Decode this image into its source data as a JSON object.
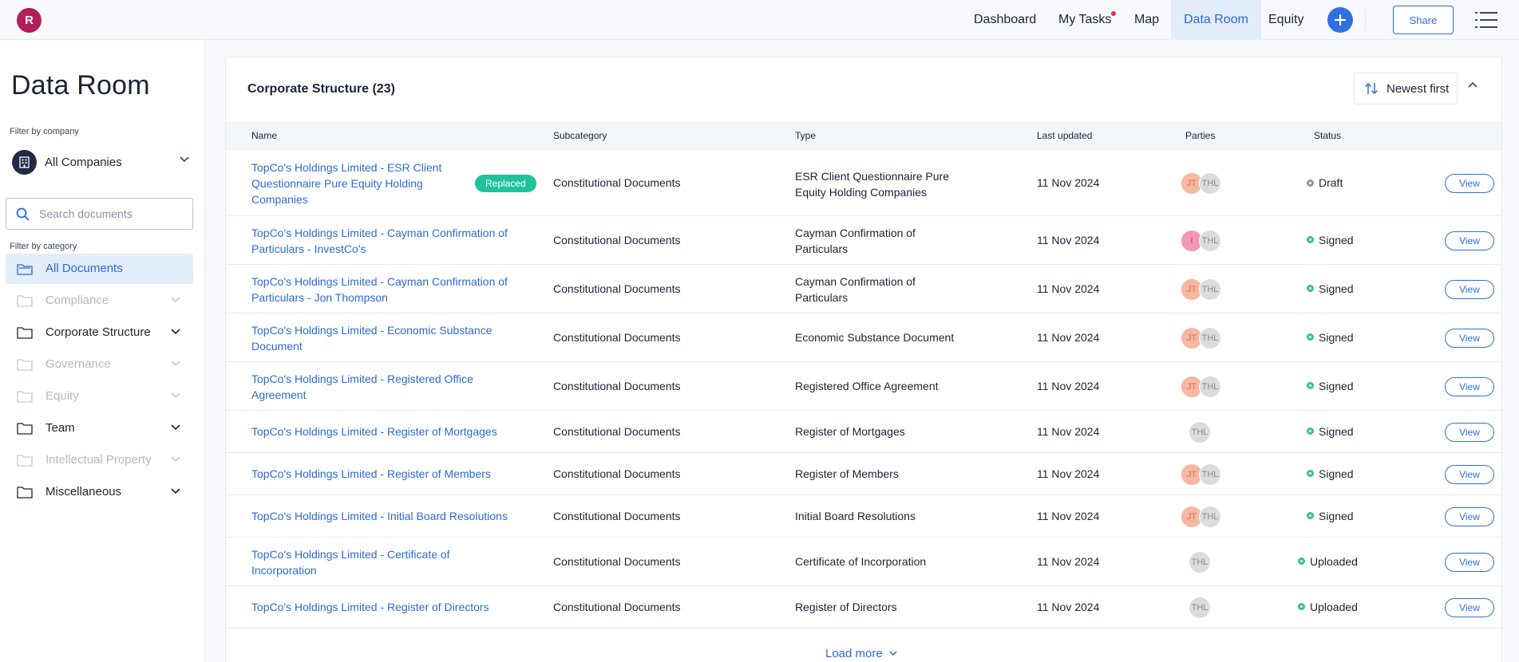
{
  "user": {
    "initial": "R"
  },
  "nav": {
    "items": [
      {
        "label": "Dashboard"
      },
      {
        "label": "My Tasks"
      },
      {
        "label": "Map"
      },
      {
        "label": "Data Room"
      },
      {
        "label": "Equity"
      }
    ],
    "share_label": "Share"
  },
  "sidebar": {
    "title": "Data Room",
    "filter_company_label": "Filter by company",
    "company": "All Companies",
    "search_placeholder": "Search documents",
    "filter_category_label": "Filter by category",
    "categories": [
      {
        "label": "All Documents",
        "state": "active"
      },
      {
        "label": "Compliance",
        "state": "disabled"
      },
      {
        "label": "Corporate Structure",
        "state": "normal"
      },
      {
        "label": "Governance",
        "state": "disabled"
      },
      {
        "label": "Equity",
        "state": "disabled"
      },
      {
        "label": "Team",
        "state": "normal"
      },
      {
        "label": "Intellectual Property",
        "state": "disabled"
      },
      {
        "label": "Miscellaneous",
        "state": "normal"
      }
    ]
  },
  "main": {
    "title": "Corporate Structure (23)",
    "sort_label": "Newest first",
    "columns": {
      "name": "Name",
      "subcategory": "Subcategory",
      "type": "Type",
      "last_updated": "Last updated",
      "parties": "Parties",
      "status": "Status"
    },
    "rows": [
      {
        "name": "TopCo's Holdings Limited - ESR Client Questionnaire Pure Equity Holding Companies",
        "badge": "Replaced",
        "subcategory": "Constitutional Documents",
        "type": "ESR Client Questionnaire Pure Equity Holding Companies",
        "date": "11 Nov 2024",
        "parties": [
          "JT",
          "THL"
        ],
        "status": "Draft"
      },
      {
        "name": "TopCo's Holdings Limited - Cayman Confirmation of Particulars - InvestCo's",
        "subcategory": "Constitutional Documents",
        "type": "Cayman Confirmation of Particulars",
        "date": "11 Nov 2024",
        "parties": [
          "I",
          "THL"
        ],
        "status": "Signed"
      },
      {
        "name": "TopCo's Holdings Limited - Cayman Confirmation of Particulars - Jon Thompson",
        "subcategory": "Constitutional Documents",
        "type": "Cayman Confirmation of Particulars",
        "date": "11 Nov 2024",
        "parties": [
          "JT",
          "THL"
        ],
        "status": "Signed"
      },
      {
        "name": "TopCo's Holdings Limited - Economic Substance Document",
        "subcategory": "Constitutional Documents",
        "type": "Economic Substance Document",
        "date": "11 Nov 2024",
        "parties": [
          "JT",
          "THL"
        ],
        "status": "Signed"
      },
      {
        "name": "TopCo's Holdings Limited - Registered Office Agreement",
        "subcategory": "Constitutional Documents",
        "type": "Registered Office Agreement",
        "date": "11 Nov 2024",
        "parties": [
          "JT",
          "THL"
        ],
        "status": "Signed"
      },
      {
        "name": "TopCo's Holdings Limited - Register of Mortgages",
        "subcategory": "Constitutional Documents",
        "type": "Register of Mortgages",
        "date": "11 Nov 2024",
        "parties": [
          "THL"
        ],
        "status": "Signed"
      },
      {
        "name": "TopCo's Holdings Limited - Register of Members",
        "subcategory": "Constitutional Documents",
        "type": "Register of Members",
        "date": "11 Nov 2024",
        "parties": [
          "JT",
          "THL"
        ],
        "status": "Signed"
      },
      {
        "name": "TopCo's Holdings Limited - Initial Board Resolutions",
        "subcategory": "Constitutional Documents",
        "type": "Initial Board Resolutions",
        "date": "11 Nov 2024",
        "parties": [
          "JT",
          "THL"
        ],
        "status": "Signed"
      },
      {
        "name": "TopCo's Holdings Limited - Certificate of Incorporation",
        "subcategory": "Constitutional Documents",
        "type": "Certificate of Incorporation",
        "date": "11 Nov 2024",
        "parties": [
          "THL"
        ],
        "status": "Uploaded"
      },
      {
        "name": "TopCo's Holdings Limited - Register of Directors",
        "subcategory": "Constitutional Documents",
        "type": "Register of Directors",
        "date": "11 Nov 2024",
        "parties": [
          "THL"
        ],
        "status": "Uploaded"
      }
    ],
    "view_label": "View",
    "load_more_label": "Load more"
  },
  "colors": {
    "accent": "#2f6fe0",
    "brand_avatar": "#b21f5a",
    "badge_replaced": "#20c29a",
    "status_signed": "#34c77b",
    "status_draft": "#8a93a3",
    "notification": "#e3344b"
  }
}
